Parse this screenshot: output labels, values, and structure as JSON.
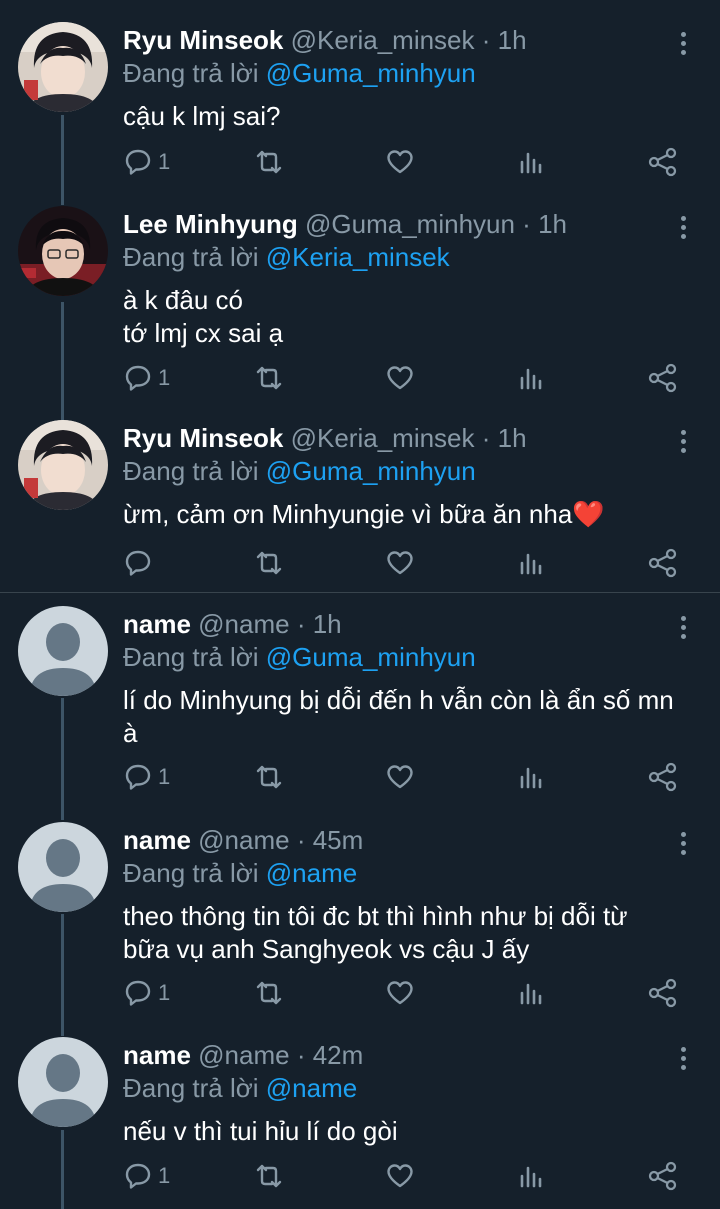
{
  "colors": {
    "background": "#15202b",
    "secondary_text": "#8899a6",
    "link": "#1da1f2",
    "divider": "#38444d"
  },
  "icons": [
    "reply-icon",
    "retweet-icon",
    "like-icon",
    "analytics-icon",
    "share-icon",
    "more-icon"
  ],
  "tweets": [
    {
      "name": "Ryu Minseok",
      "handle": "@Keria_minsek",
      "dot": " · ",
      "time": "1h",
      "reply_prefix": "Đang trả lời ",
      "reply_to": "@Guma_minhyun",
      "lines": [
        "cậu k lmj sai?"
      ],
      "reply_count": "1",
      "avatar": "photo-ryu"
    },
    {
      "name": "Lee Minhyung",
      "handle": "@Guma_minhyun",
      "dot": " · ",
      "time": "1h",
      "reply_prefix": "Đang trả lời ",
      "reply_to": "@Keria_minsek",
      "lines": [
        "à k đâu có",
        "tớ lmj cx sai ạ"
      ],
      "reply_count": "1",
      "avatar": "photo-lee"
    },
    {
      "name": "Ryu Minseok",
      "handle": "@Keria_minsek",
      "dot": " · ",
      "time": "1h",
      "reply_prefix": "Đang trả lời ",
      "reply_to": "@Guma_minhyun",
      "lines": [
        "ừm, cảm ơn Minhyungie vì bữa ăn nha"
      ],
      "emoji": "❤️",
      "reply_count": "",
      "avatar": "photo-ryu"
    },
    {
      "name": "name",
      "handle": "@name",
      "dot": " · ",
      "time": "1h",
      "reply_prefix": "Đang trả lời ",
      "reply_to": "@Guma_minhyun",
      "lines": [
        "lí do Minhyung bị dỗi đến h vẫn còn là ẩn số mn",
        "à"
      ],
      "reply_count": "1",
      "avatar": "default"
    },
    {
      "name": "name",
      "handle": "@name",
      "dot": " · ",
      "time": "45m",
      "reply_prefix": "Đang trả lời ",
      "reply_to": "@name",
      "lines": [
        "theo thông tin tôi đc bt thì hình như bị dỗi từ",
        "bữa vụ anh Sanghyeok vs cậu J ấy"
      ],
      "reply_count": "1",
      "avatar": "default"
    },
    {
      "name": "name",
      "handle": "@name",
      "dot": " · ",
      "time": "42m",
      "reply_prefix": "Đang trả lời ",
      "reply_to": "@name",
      "lines": [
        "nếu v thì tui hỉu lí do gòi"
      ],
      "reply_count": "1",
      "avatar": "default"
    }
  ]
}
